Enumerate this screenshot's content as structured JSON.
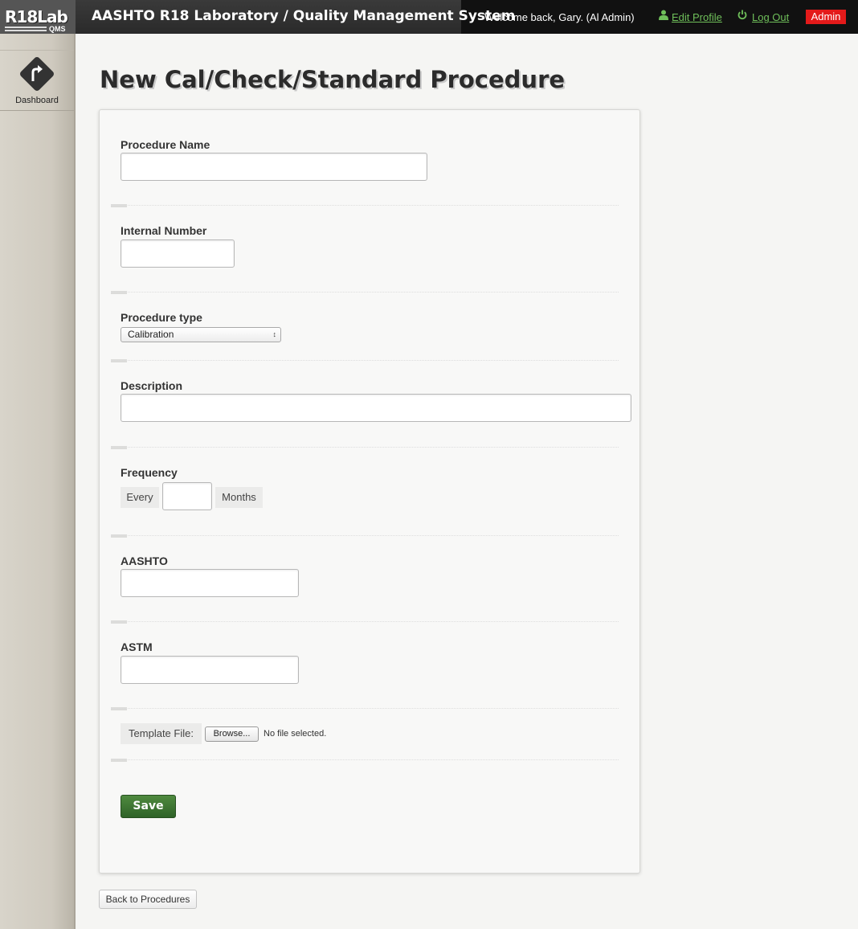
{
  "header": {
    "logo_text": "R18Lab",
    "logo_sub": "QMS",
    "app_title": "AASHTO R18 Laboratory / Quality Management System",
    "welcome_text": "Welcome back, Gary. (Al Admin)",
    "edit_profile_label": "Edit Profile",
    "log_out_label": "Log Out",
    "admin_badge": "Admin",
    "accent_color": "#6fbf5a",
    "badge_color": "#e41a1a"
  },
  "sidebar": {
    "items": [
      {
        "label": "Dashboard",
        "icon": "turn-arrow-icon"
      }
    ]
  },
  "page": {
    "title": "New Cal/Check/Standard Procedure"
  },
  "form": {
    "procedure_name": {
      "label": "Procedure Name",
      "value": ""
    },
    "internal_number": {
      "label": "Internal Number",
      "value": ""
    },
    "procedure_type": {
      "label": "Procedure type",
      "selected": "Calibration"
    },
    "description": {
      "label": "Description",
      "value": ""
    },
    "frequency": {
      "label": "Frequency",
      "prefix": "Every",
      "value": "",
      "suffix": "Months"
    },
    "aashto": {
      "label": "AASHTO",
      "value": ""
    },
    "astm": {
      "label": "ASTM",
      "value": ""
    },
    "template_file": {
      "label": "Template File:",
      "browse_label": "Browse...",
      "status": "No file selected."
    },
    "save_label": "Save",
    "save_color": "#3d7533"
  },
  "footer": {
    "back_label": "Back to Procedures"
  }
}
